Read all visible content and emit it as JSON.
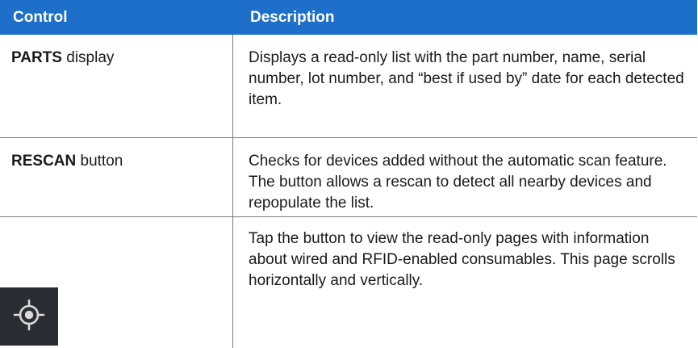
{
  "header": {
    "col1": "Control",
    "col2": "Description"
  },
  "rows": [
    {
      "control_bold": "PARTS",
      "control_rest": " display",
      "description": "Displays a read-only list with the part number, name, serial number, lot number, and “best if used by” date for each detected item."
    },
    {
      "control_bold": "RESCAN",
      "control_rest": " button",
      "description": "Checks for devices added without the automatic scan feature. The button allows a rescan to detect all nearby devices and repopulate the list."
    },
    {
      "control_icon": "crosshair-target-icon",
      "description": "Tap the button to view the read-only pages with information about wired and RFID-enabled consumables. This page scrolls horizontally and vertically."
    }
  ],
  "colors": {
    "header_bg": "#1e6fc9",
    "header_text": "#ffffff",
    "icon_button_bg": "#2a2d33",
    "icon_color": "#d9dadc"
  }
}
